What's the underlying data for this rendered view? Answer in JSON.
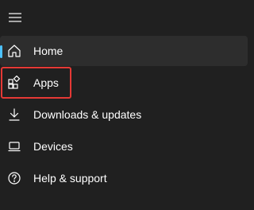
{
  "menu": {
    "hamburger_icon": "hamburger-menu-icon"
  },
  "nav": {
    "items": [
      {
        "label": "Home",
        "icon": "home-icon",
        "selected": true
      },
      {
        "label": "Apps",
        "icon": "apps-icon",
        "highlighted": true
      },
      {
        "label": "Downloads & updates",
        "icon": "download-icon"
      },
      {
        "label": "Devices",
        "icon": "laptop-icon"
      },
      {
        "label": "Help & support",
        "icon": "question-circle-icon"
      }
    ]
  },
  "colors": {
    "background": "#202020",
    "selected_background": "#2d2d2d",
    "accent": "#4cc2ff",
    "highlight_border": "#e53935",
    "text": "#ffffff"
  }
}
